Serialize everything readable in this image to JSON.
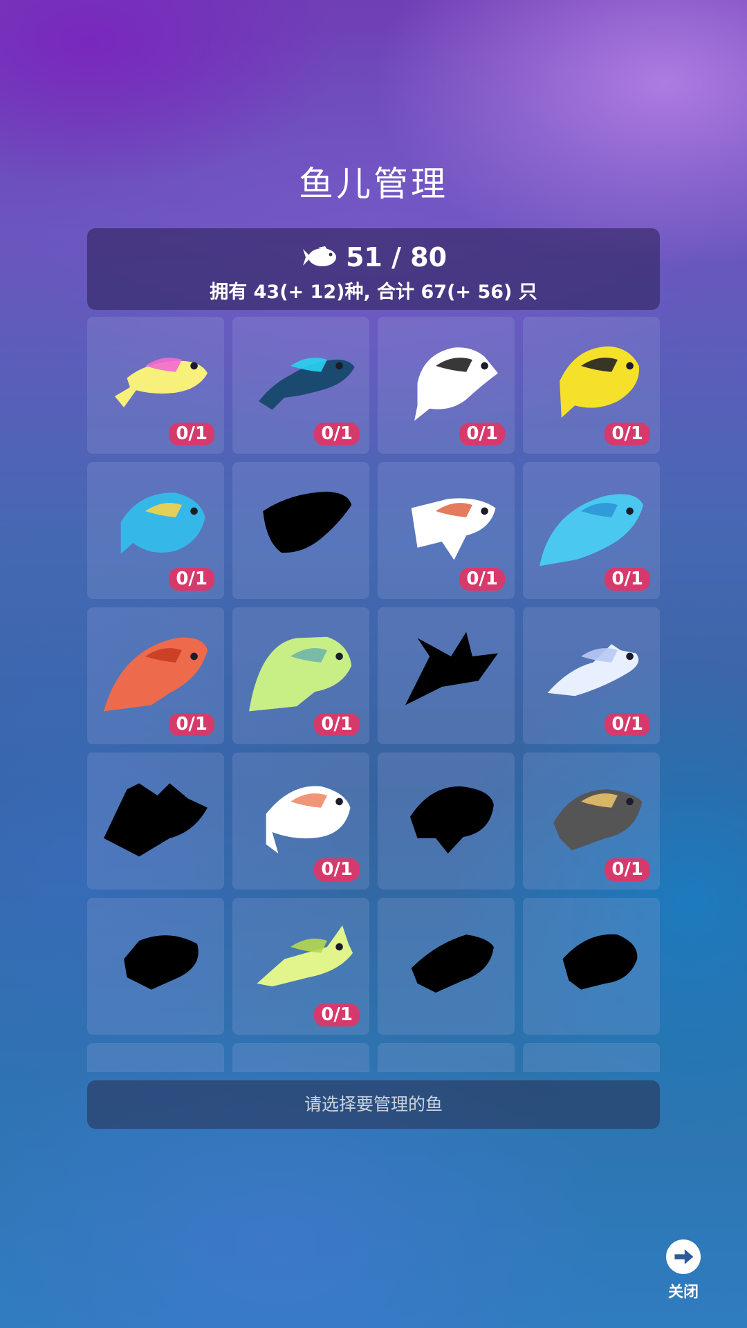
{
  "header": {
    "title": "鱼儿管理"
  },
  "stats": {
    "icon": "fish-icon",
    "count": "51 / 80",
    "summary": "拥有 43(+ 12)种, 合计 67(+ 56) 只"
  },
  "fish": [
    {
      "name": "pink-yellow-fish",
      "owned": true,
      "badge": "0/1",
      "colors": [
        "#f7f07a",
        "#f36ad0"
      ]
    },
    {
      "name": "blue-neon-fish",
      "owned": true,
      "badge": "0/1",
      "colors": [
        "#1a4a70",
        "#29d3ef"
      ]
    },
    {
      "name": "black-white-butterflyfish",
      "owned": true,
      "badge": "0/1",
      "colors": [
        "#ffffff",
        "#222222"
      ]
    },
    {
      "name": "yellow-butterflyfish",
      "owned": true,
      "badge": "0/1",
      "colors": [
        "#f5e02a",
        "#222222"
      ]
    },
    {
      "name": "striped-angelfish",
      "owned": true,
      "badge": "0/1",
      "colors": [
        "#35b8e8",
        "#f6d34a"
      ]
    },
    {
      "name": "silhouette-1",
      "owned": false,
      "badge": ""
    },
    {
      "name": "white-angelfish",
      "owned": true,
      "badge": "0/1",
      "colors": [
        "#ffffff",
        "#e36b4c"
      ]
    },
    {
      "name": "blue-grouper",
      "owned": true,
      "badge": "0/1",
      "colors": [
        "#4ac8f0",
        "#2d95d8"
      ]
    },
    {
      "name": "red-grouper",
      "owned": true,
      "badge": "0/1",
      "colors": [
        "#ee6a4c",
        "#c73c24"
      ]
    },
    {
      "name": "green-leaf-fish",
      "owned": true,
      "badge": "0/1",
      "colors": [
        "#c8ee86",
        "#6fb6a8"
      ]
    },
    {
      "name": "silhouette-2",
      "owned": false,
      "badge": ""
    },
    {
      "name": "white-nudibranch",
      "owned": true,
      "badge": "0/1",
      "colors": [
        "#e8f0ff",
        "#b9c9f5"
      ]
    },
    {
      "name": "silhouette-lionfish",
      "owned": false,
      "badge": ""
    },
    {
      "name": "white-pufferfish",
      "owned": true,
      "badge": "0/1",
      "colors": [
        "#ffffff",
        "#ef8a6a"
      ]
    },
    {
      "name": "silhouette-3",
      "owned": false,
      "badge": ""
    },
    {
      "name": "gray-triggerfish",
      "owned": true,
      "badge": "0/1",
      "colors": [
        "#555555",
        "#e8c06a"
      ]
    },
    {
      "name": "silhouette-4",
      "owned": false,
      "badge": ""
    },
    {
      "name": "green-cowfish",
      "owned": true,
      "badge": "0/1",
      "colors": [
        "#e2f58a",
        "#b5d84f"
      ]
    },
    {
      "name": "silhouette-5",
      "owned": false,
      "badge": ""
    },
    {
      "name": "silhouette-6",
      "owned": false,
      "badge": ""
    },
    {
      "name": "partial-1",
      "owned": false,
      "badge": ""
    },
    {
      "name": "partial-2",
      "owned": false,
      "badge": ""
    },
    {
      "name": "partial-3",
      "owned": false,
      "badge": ""
    },
    {
      "name": "partial-4",
      "owned": false,
      "badge": ""
    }
  ],
  "bottom_bar": {
    "hint": "请选择要管理的鱼"
  },
  "close": {
    "label": "关闭",
    "icon": "arrow-right-icon"
  }
}
